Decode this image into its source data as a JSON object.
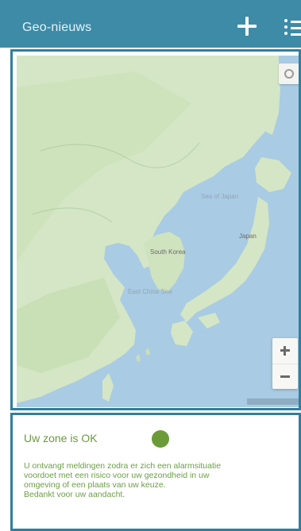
{
  "app": {
    "title": "Geo-nieuws"
  },
  "toolbar": {
    "add_icon": "plus-icon",
    "menu_icon": "list-menu-icon"
  },
  "map": {
    "labels": {
      "sea_of_japan": "Sea of Japan",
      "korea": "South Korea",
      "japan": "Japan",
      "east_china_sea": "East China Sea"
    },
    "controls": {
      "zoom_in": "+",
      "zoom_out": "−",
      "locate_icon": "my-location-icon"
    }
  },
  "status": {
    "label": "Uw zone is OK",
    "indicator_color": "#6a9b38"
  },
  "info": {
    "line1": "U ontvangt meldingen zodra er zich een alarmsituatie",
    "line2": "voordoet met een risico voor uw gezondheid in uw",
    "line3": "omgeving of een plaats van uw keuze.",
    "line4": "Bedankt voor uw aandacht."
  },
  "colors": {
    "appbar": "#3d8ba6",
    "frame": "#2e7fa0",
    "water": "#a9cbe3",
    "land": "#d6e7c8",
    "status_green": "#6c9a40"
  }
}
